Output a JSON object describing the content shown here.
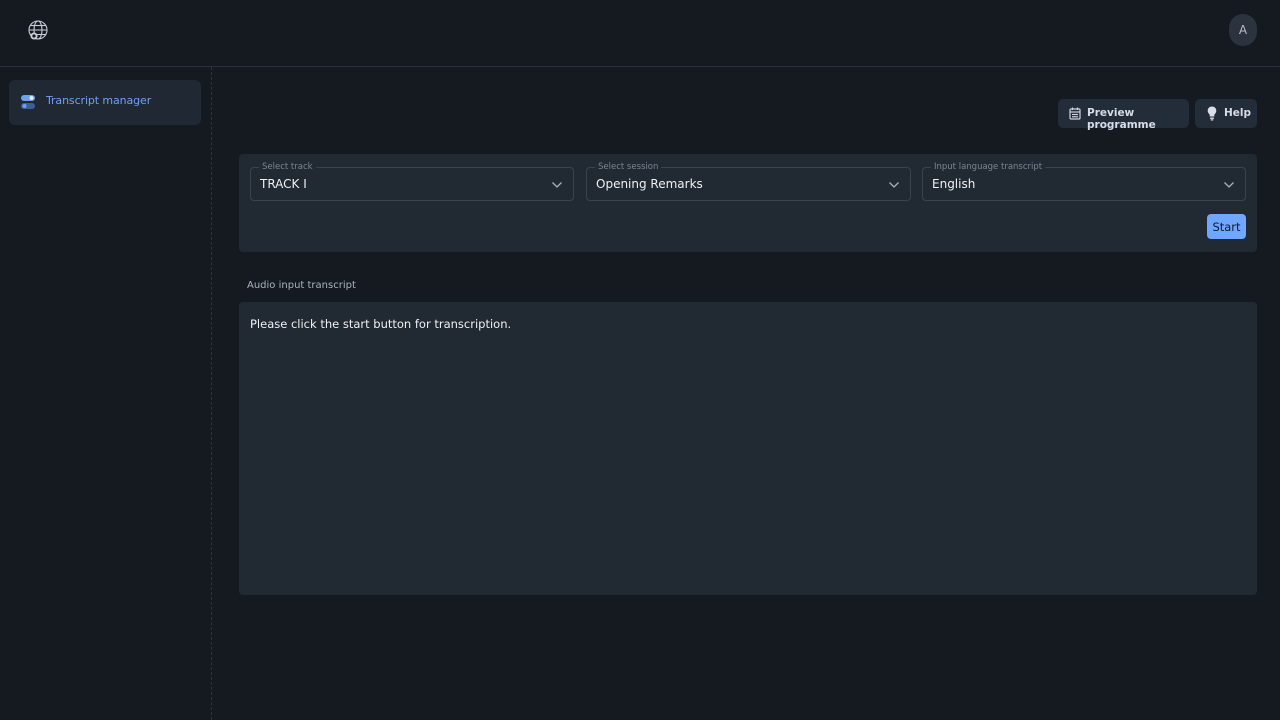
{
  "header": {
    "logo_icon": "globe-network-icon",
    "avatar_initial": "A"
  },
  "sidebar": {
    "items": [
      {
        "label": "Transcript manager",
        "icon": "toggle-icon",
        "active": true
      }
    ]
  },
  "toolbar": {
    "preview_label": "Preview programme",
    "preview_icon": "calendar-icon",
    "help_label": "Help",
    "help_icon": "lightbulb-icon"
  },
  "controls": {
    "track": {
      "legend": "Select track",
      "value": "TRACK I"
    },
    "session": {
      "legend": "Select session",
      "value": "Opening Remarks"
    },
    "language": {
      "legend": "Input language transcript",
      "value": "English"
    },
    "start_label": "Start"
  },
  "transcript": {
    "label": "Audio input transcript",
    "text": "Please click the start button for transcription."
  },
  "colors": {
    "background": "#151a21",
    "panel": "#212932",
    "accent": "#6fa6ff",
    "nav_active_text": "#6ea1f3"
  }
}
